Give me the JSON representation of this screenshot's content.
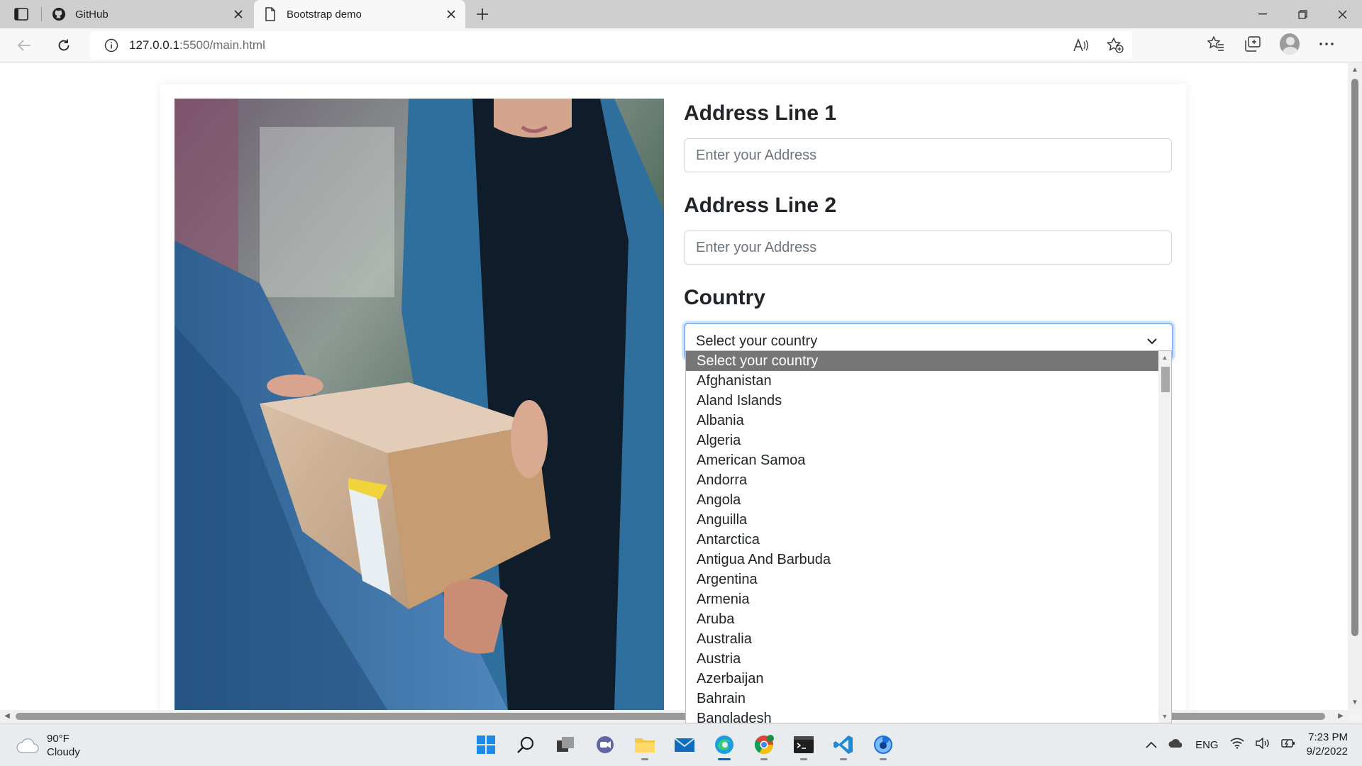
{
  "browser": {
    "tabs": [
      {
        "title": "GitHub",
        "active": false
      },
      {
        "title": "Bootstrap demo",
        "active": true
      }
    ],
    "url_host": "127.0.0.1",
    "url_rest": ":5500/main.html"
  },
  "form": {
    "address1_label": "Address Line 1",
    "address1_placeholder": "Enter your Address",
    "address2_label": "Address Line 2",
    "address2_placeholder": "Enter your Address",
    "country_label": "Country",
    "country_selected": "Select your country",
    "country_options": [
      "Select your country",
      "Afghanistan",
      "Aland Islands",
      "Albania",
      "Algeria",
      "American Samoa",
      "Andorra",
      "Angola",
      "Anguilla",
      "Antarctica",
      "Antigua And Barbuda",
      "Argentina",
      "Armenia",
      "Aruba",
      "Australia",
      "Austria",
      "Azerbaijan",
      "Bahrain",
      "Bangladesh"
    ]
  },
  "taskbar": {
    "weather_temp": "90°F",
    "weather_desc": "Cloudy",
    "language": "ENG",
    "time": "7:23 PM",
    "date": "9/2/2022"
  },
  "colors": {
    "focus_border": "#86b7fe",
    "selected_option": "#767676",
    "active_app": "#0067c0"
  }
}
